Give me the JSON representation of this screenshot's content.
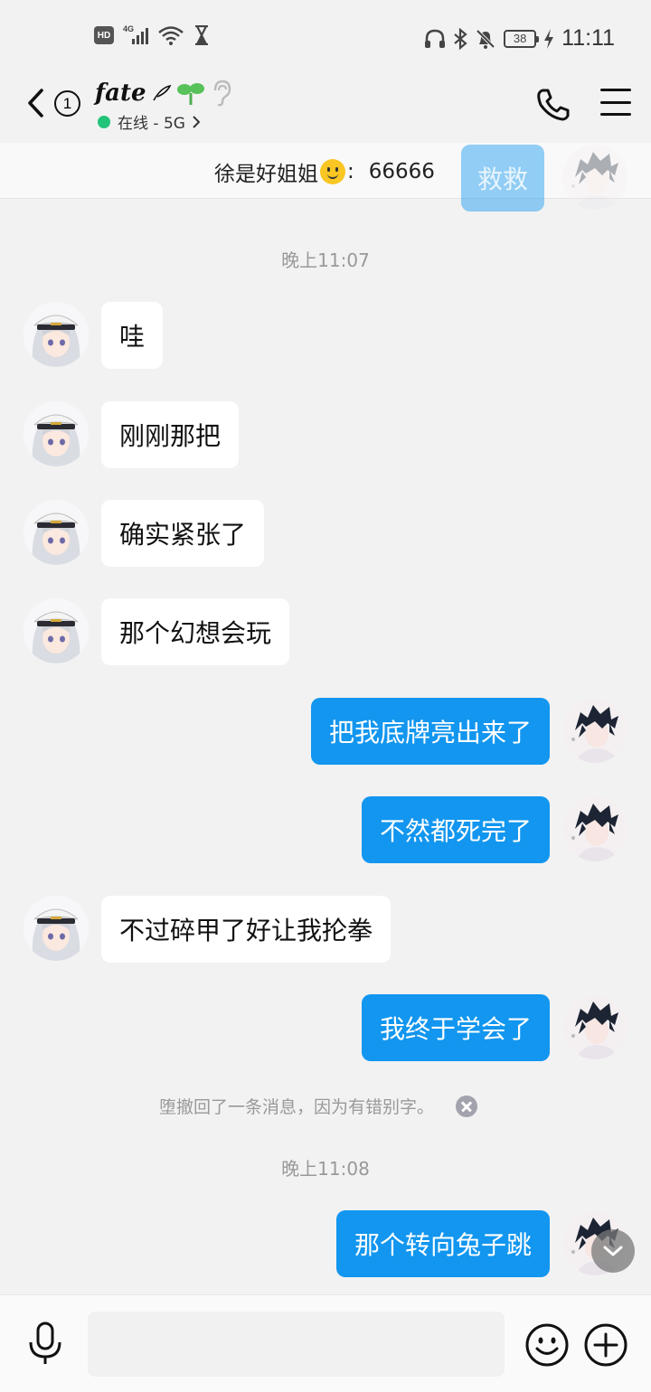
{
  "status_bar": {
    "hd": "HD",
    "network": "4G",
    "battery": "38",
    "time": "11:11",
    "icons": [
      "hd-icon",
      "signal-icon",
      "wifi-icon",
      "hourglass-icon",
      "headphones-icon",
      "bluetooth-icon",
      "mute-icon",
      "battery-icon",
      "charging-icon"
    ]
  },
  "header": {
    "unread_count": "1",
    "title": "fate",
    "status": "在线 - 5G",
    "icons": [
      "back-icon",
      "sprout-icon",
      "ear-icon",
      "phone-icon",
      "menu-icon"
    ]
  },
  "pinned": {
    "sender": "徐是好姐姐",
    "separator": ":",
    "text": "66666"
  },
  "ghost_bubble": "救救",
  "messages": {
    "time1": "晚上11:07",
    "m1": "哇",
    "m2": "刚刚那把",
    "m3": "确实紧张了",
    "m4": "那个幻想会玩",
    "m5": "把我底牌亮出来了",
    "m6": "不然都死完了",
    "m7": "不过碎甲了好让我抡拳",
    "m8": "我终于学会了",
    "recall": "堕撤回了一条消息，因为有错别字。",
    "time2": "晚上11:08",
    "m9": "那个转向兔子跳"
  },
  "input": {
    "placeholder": "",
    "value": ""
  },
  "colors": {
    "accent": "#1296ef",
    "background": "#f2f2f2",
    "online": "#22c47a"
  }
}
